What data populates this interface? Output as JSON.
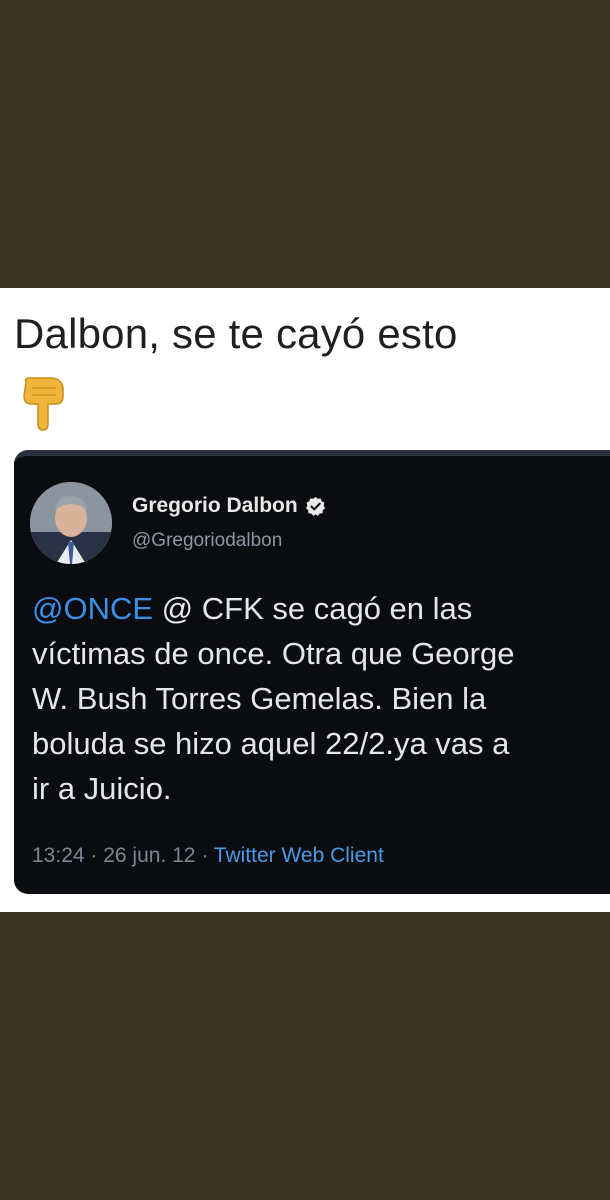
{
  "post": {
    "caption": "Dalbon, se te cayó esto",
    "emoji": "pointing-down-hand"
  },
  "tweet": {
    "author_name": "Gregorio Dalbon",
    "author_handle": "@Gregoriodalbon",
    "verified": true,
    "mention": "@ONCE",
    "text_line1_rest": " @ CFK se cagó en las",
    "text_rest": "víctimas de once. Otra que George\nW. Bush Torres Gemelas. Bien la\nboluda se hizo aquel 22/2.ya vas a\nir a Juicio.",
    "time": "13:24",
    "date": "26 jun. 12",
    "separator": " · ",
    "client": "Twitter Web Client"
  },
  "colors": {
    "background": "#3b3623",
    "tweet_bg": "#0b0c10",
    "link": "#3b8fe6"
  }
}
